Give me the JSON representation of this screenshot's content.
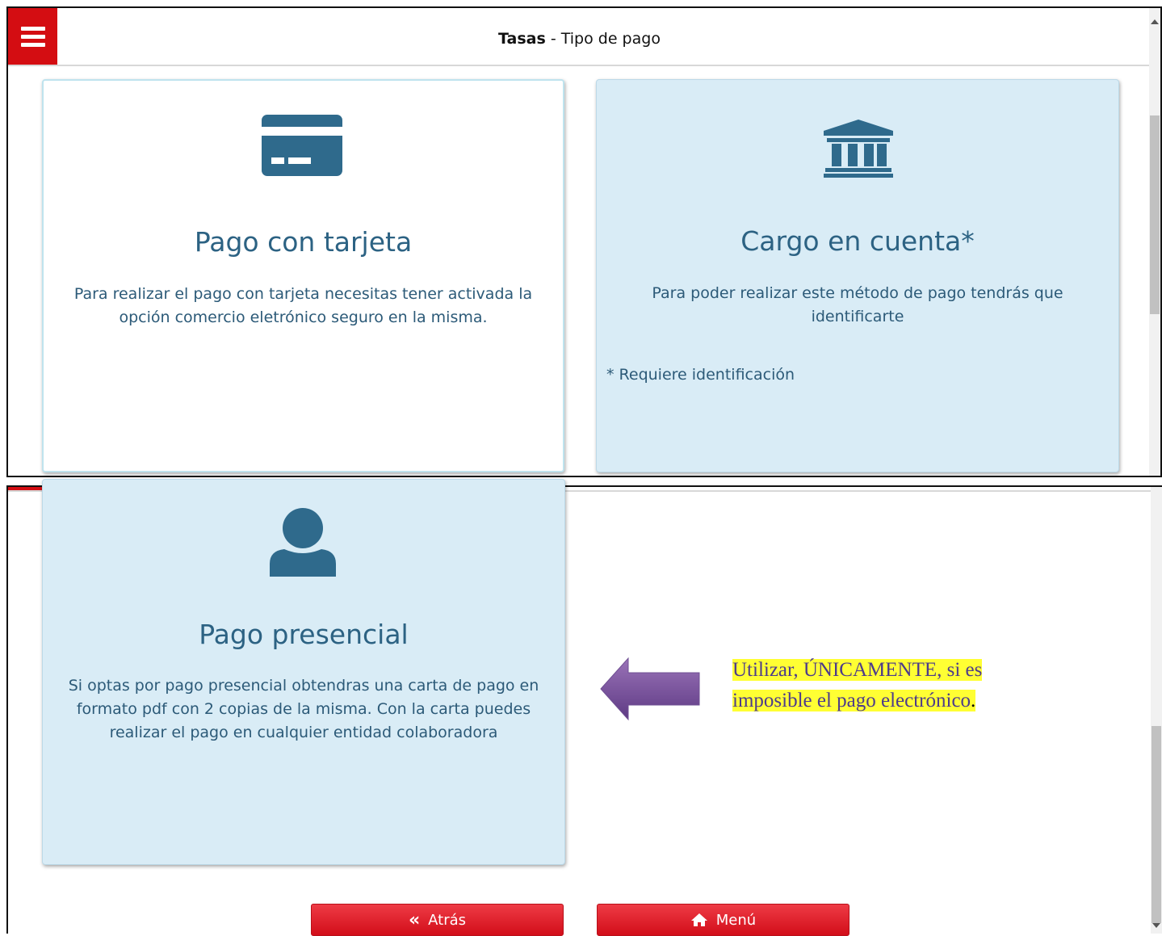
{
  "header": {
    "title_bold": "Tasas",
    "title_rest": " - Tipo de pago"
  },
  "cards": {
    "tarjeta": {
      "icon": "credit-card-icon",
      "title": "Pago con tarjeta",
      "description": "Para realizar el pago con tarjeta necesitas tener activada la opción comercio eletrónico seguro en la misma."
    },
    "cuenta": {
      "icon": "bank-icon",
      "title": "Cargo en cuenta*",
      "description": "Para poder realizar este método de pago tendrás que identificarte",
      "note": "* Requiere identificación"
    },
    "presencial": {
      "icon": "user-icon",
      "title": "Pago presencial",
      "description": "Si optas por pago presencial obtendras una carta de pago en formato pdf con 2 copias de la misma. Con la carta puedes realizar el pago en cualquier entidad colaboradora"
    }
  },
  "buttons": {
    "back": "Atrás",
    "menu": "Menú"
  },
  "annotation": {
    "line1": "Utilizar, ÚNICAMENTE, si es",
    "line2": "imposible el pago electrónico",
    "line2_end": "."
  },
  "colors": {
    "brand_red": "#d40d12",
    "card_blue": "#d9ecf6",
    "icon_blue": "#2f6a8c",
    "highlight": "#ffff33",
    "arrow_purple": "#7a4f9a"
  }
}
